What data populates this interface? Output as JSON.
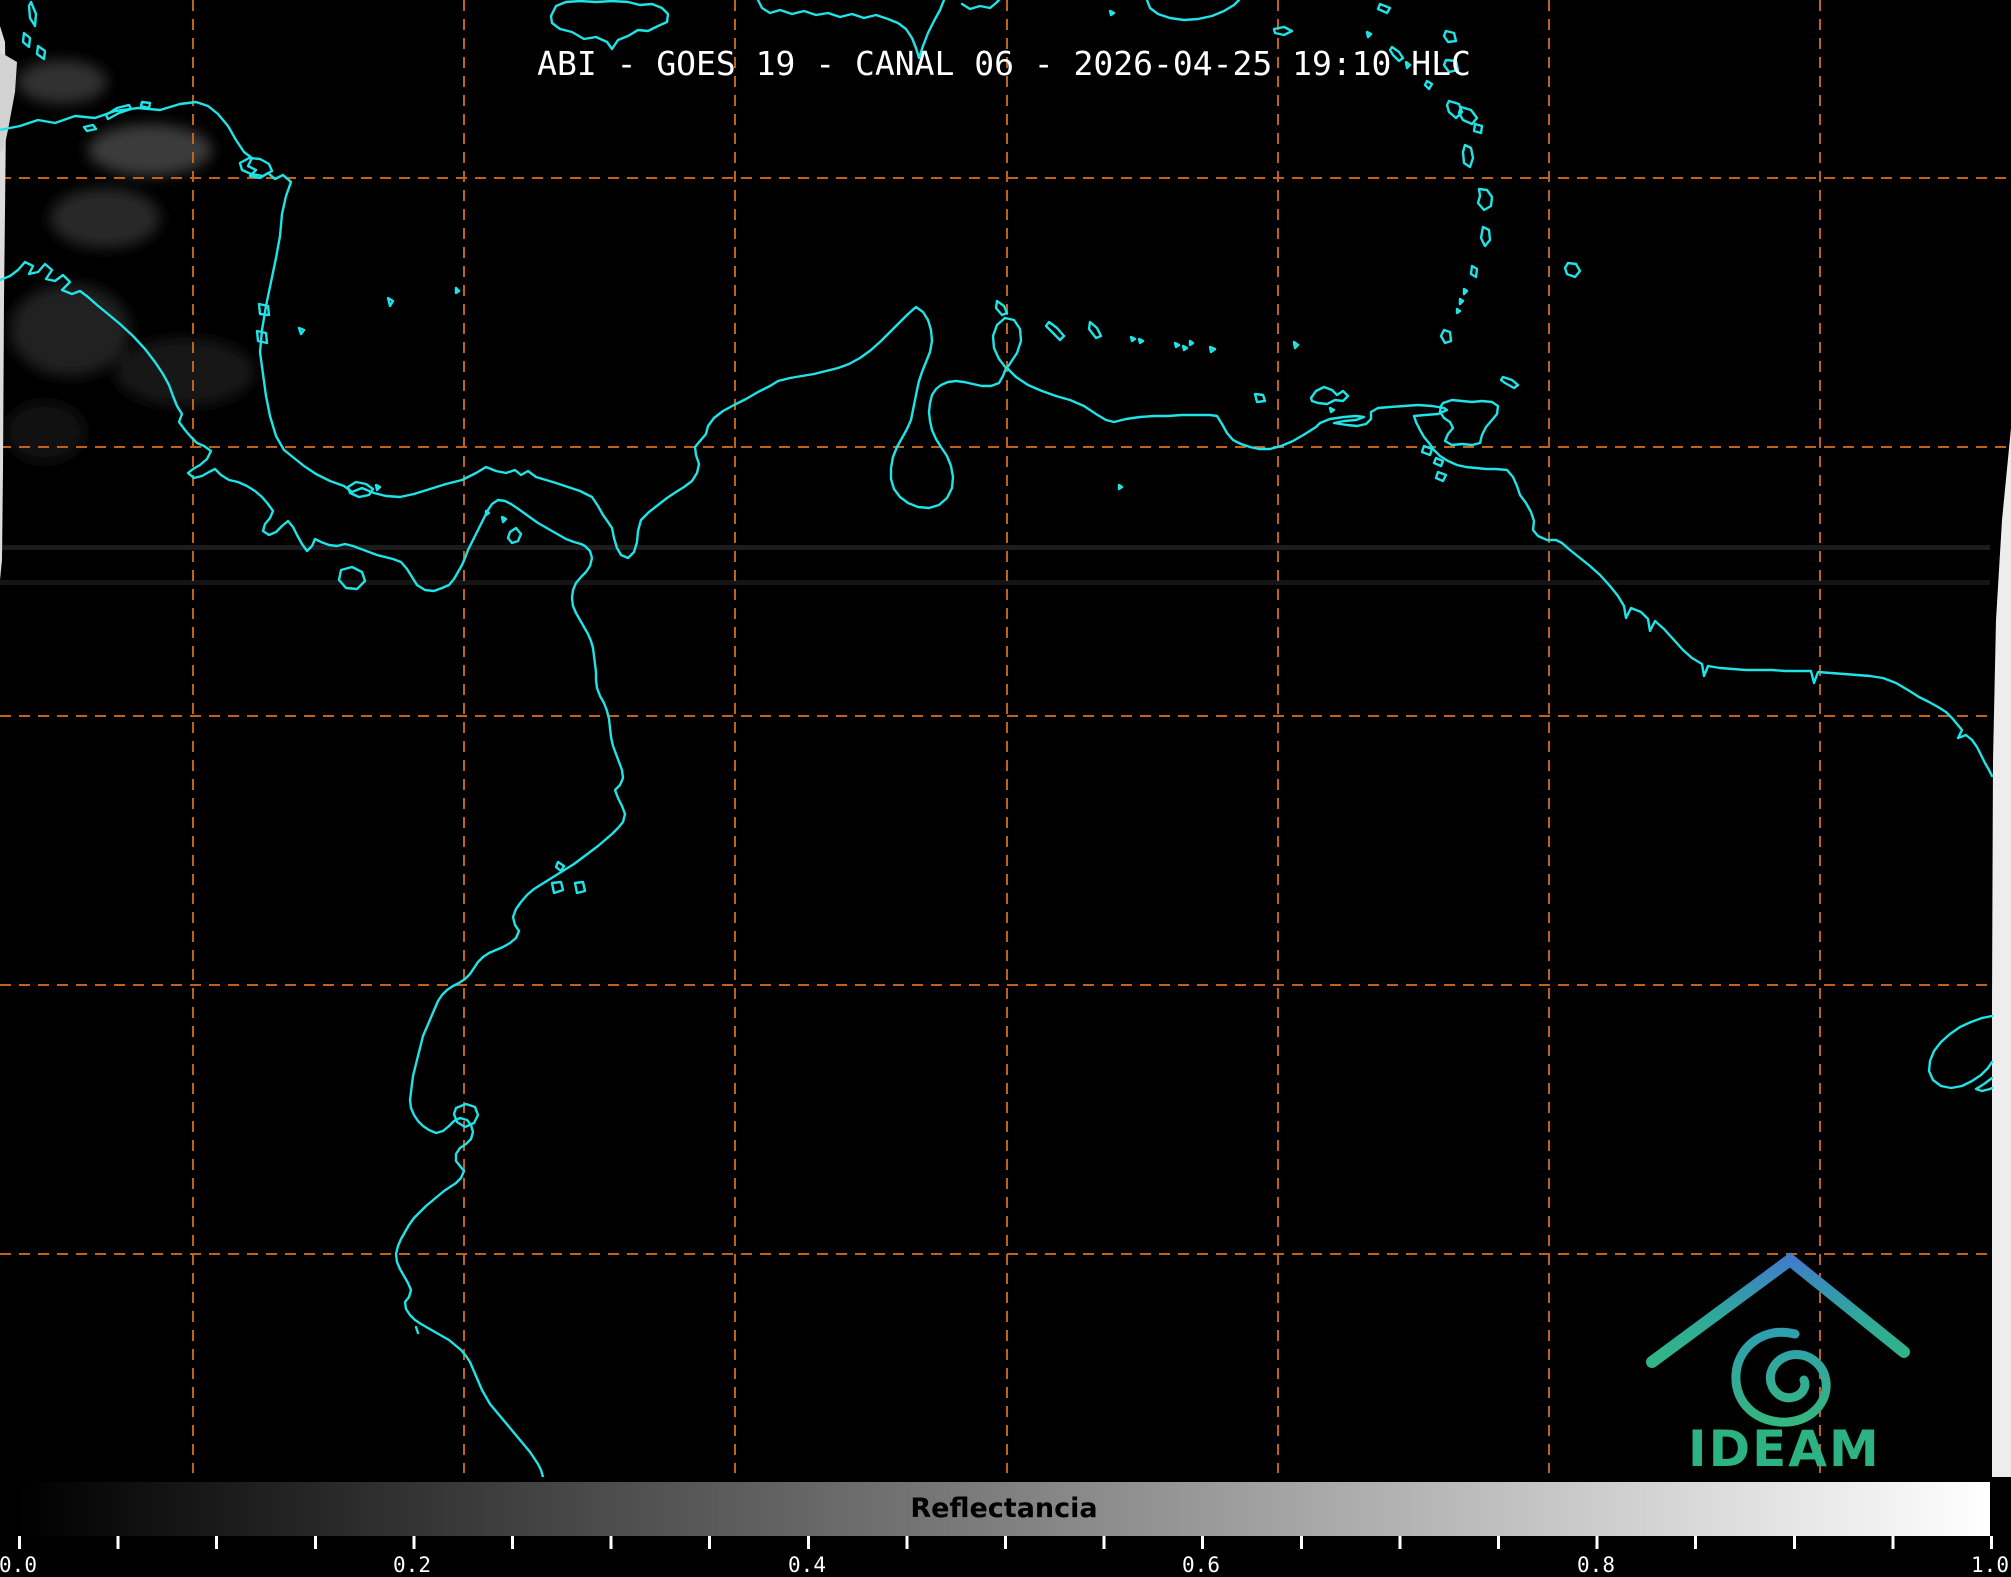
{
  "title": "ABI - GOES 19 - CANAL 06 - 2026-04-25 19:10 HLC",
  "colorbar": {
    "label": "Reflectancia",
    "ticks": [
      "0.0",
      "0.2",
      "0.4",
      "0.6",
      "0.8",
      "1.0"
    ],
    "range": [
      0.0,
      1.0
    ],
    "gradient_start": "#000000",
    "gradient_end": "#ffffff"
  },
  "logo": {
    "text": "IDEAM",
    "green": "#2db383",
    "blue": "#3f7dca"
  },
  "colors": {
    "background": "#000000",
    "coastline": "#1fe3e6",
    "gridline": "#c9671d",
    "title_text": "#ffffff",
    "tick_text": "#ffffff",
    "colorbar_label_text": "#000000",
    "scan_edge": "#ededed"
  }
}
